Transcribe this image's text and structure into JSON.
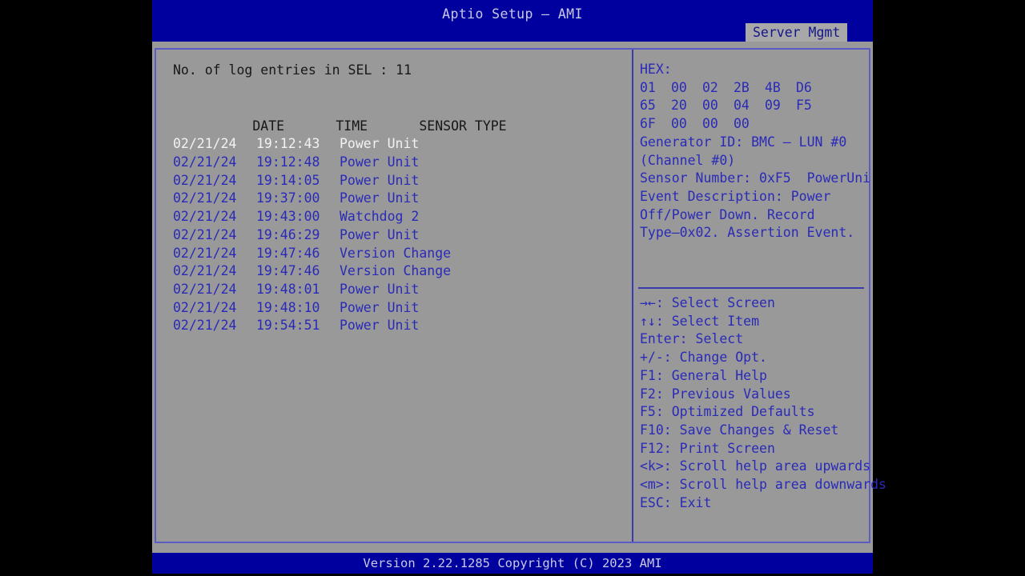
{
  "header": {
    "title": "Aptio Setup – AMI",
    "active_tab": "Server Mgmt",
    "bar_color": "#00009f",
    "title_color": "#c9c9e8"
  },
  "footer": {
    "version_text": "Version 2.22.1285 Copyright (C) 2023 AMI"
  },
  "left_pane": {
    "sel_count_label": "No. of log entries in SEL : 11",
    "columns": {
      "date": "DATE",
      "time": "TIME",
      "sensor_type": "SENSOR TYPE"
    },
    "entries": [
      {
        "date": "02/21/24",
        "time": "19:12:43",
        "sensor_type": "Power Unit",
        "selected": true
      },
      {
        "date": "02/21/24",
        "time": "19:12:48",
        "sensor_type": "Power Unit",
        "selected": false
      },
      {
        "date": "02/21/24",
        "time": "19:14:05",
        "sensor_type": "Power Unit",
        "selected": false
      },
      {
        "date": "02/21/24",
        "time": "19:37:00",
        "sensor_type": "Power Unit",
        "selected": false
      },
      {
        "date": "02/21/24",
        "time": "19:43:00",
        "sensor_type": "Watchdog 2",
        "selected": false
      },
      {
        "date": "02/21/24",
        "time": "19:46:29",
        "sensor_type": "Power Unit",
        "selected": false
      },
      {
        "date": "02/21/24",
        "time": "19:47:46",
        "sensor_type": "Version Change",
        "selected": false
      },
      {
        "date": "02/21/24",
        "time": "19:47:46",
        "sensor_type": "Version Change",
        "selected": false
      },
      {
        "date": "02/21/24",
        "time": "19:48:01",
        "sensor_type": "Power Unit",
        "selected": false
      },
      {
        "date": "02/21/24",
        "time": "19:48:10",
        "sensor_type": "Power Unit",
        "selected": false
      },
      {
        "date": "02/21/24",
        "time": "19:54:51",
        "sensor_type": "Power Unit",
        "selected": false
      }
    ]
  },
  "right_pane": {
    "hex_label": "HEX:",
    "hex_rows": [
      [
        "01",
        "00",
        "02",
        "2B",
        "4B",
        "D6"
      ],
      [
        "65",
        "20",
        "00",
        "04",
        "09",
        "F5"
      ],
      [
        "6F",
        "00",
        "00",
        "00"
      ]
    ],
    "detail_lines": [
      "Generator ID: BMC – LUN #0",
      "(Channel #0)",
      "Sensor Number: 0xF5  PowerUni",
      "Event Description: Power",
      "Off/Power Down. Record",
      "Type–0x02. Assertion Event."
    ],
    "shortcuts": [
      "→←: Select Screen",
      "↑↓: Select Item",
      "Enter: Select",
      "+/-: Change Opt.",
      "F1: General Help",
      "F2: Previous Values",
      "F5: Optimized Defaults",
      "F10: Save Changes & Reset",
      "F12: Print Screen",
      "<k>: Scroll help area upwards",
      "<m>: Scroll help area downwards",
      "ESC: Exit"
    ]
  }
}
